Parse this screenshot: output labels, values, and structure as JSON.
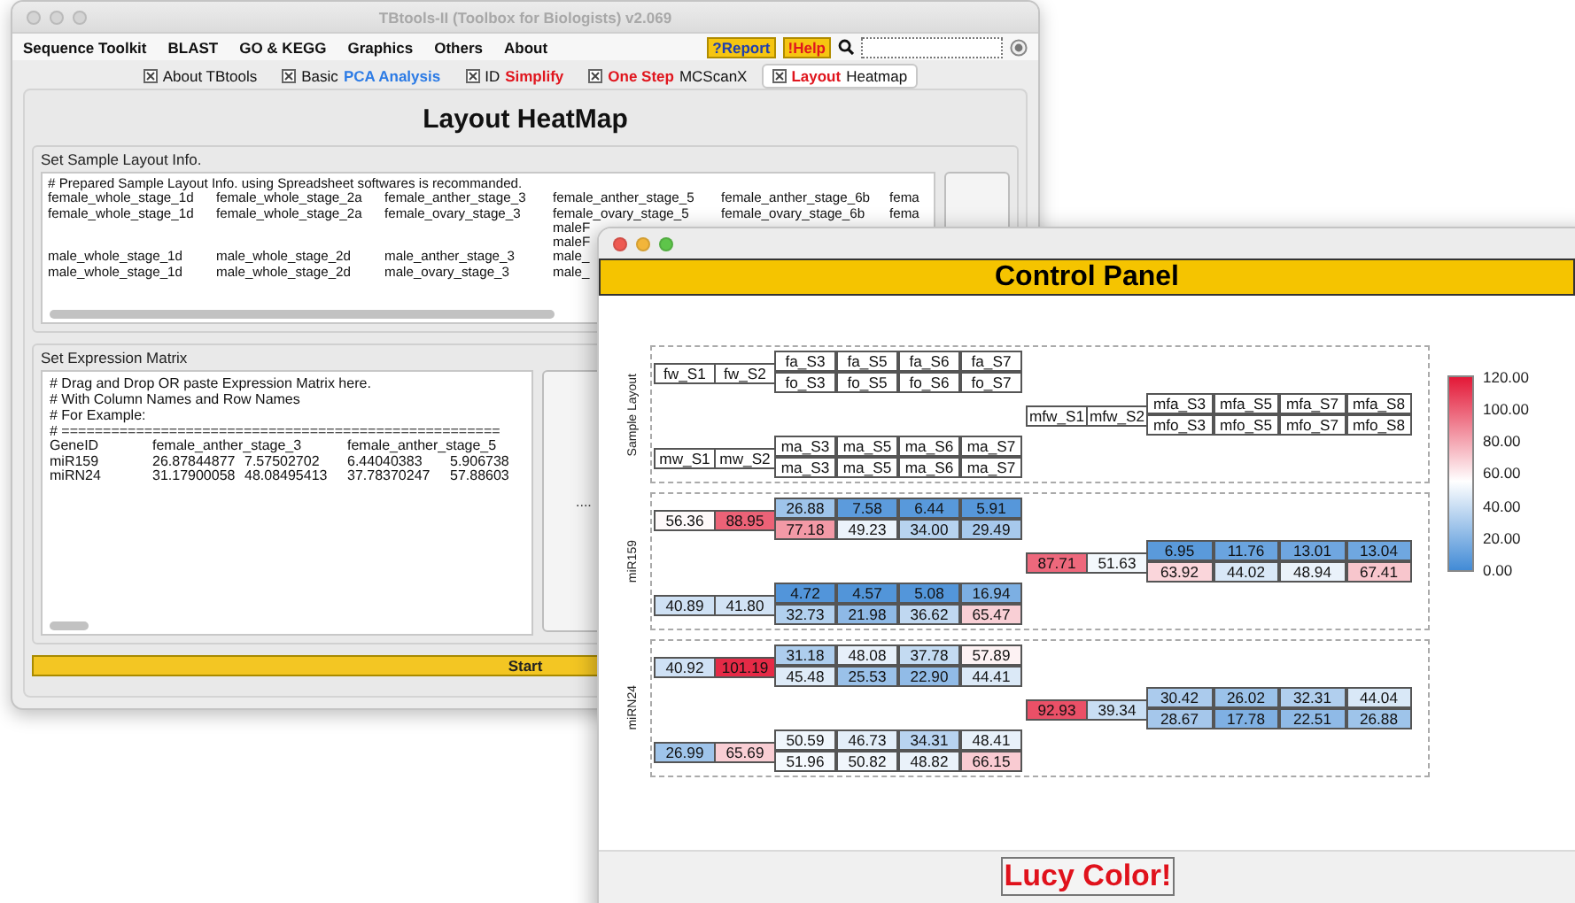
{
  "main_window": {
    "title": "TBtools-II (Toolbox for Biologists) v2.069",
    "menus": [
      "Sequence Toolkit",
      "BLAST",
      "GO & KEGG",
      "Graphics",
      "Others",
      "About"
    ],
    "report_button": "?Report",
    "help_button": "!Help",
    "tabs": [
      {
        "parts": [
          {
            "text": "About TBtools"
          }
        ],
        "selected": false
      },
      {
        "parts": [
          {
            "text": "Basic"
          },
          {
            "text": "PCA Analysis",
            "color": "#2c7be5"
          }
        ],
        "selected": false
      },
      {
        "parts": [
          {
            "text": "ID"
          },
          {
            "text": "Simplify",
            "color": "#e0161e"
          }
        ],
        "selected": false
      },
      {
        "parts": [
          {
            "text": "One Step",
            "color": "#e0161e"
          },
          {
            "text": "MCScanX"
          }
        ],
        "selected": false
      },
      {
        "parts": [
          {
            "text": "Layout",
            "color": "#e0161e"
          },
          {
            "text": "Heatmap"
          }
        ],
        "selected": true
      }
    ],
    "heading": "Layout HeatMap",
    "layout_panel": {
      "title": "Set Sample Layout Info.",
      "comment": "# Prepared Sample Layout Info. using Spreadsheet softwares is recommanded.",
      "rows": [
        [
          "female_whole_stage_1d",
          "female_whole_stage_2a",
          "female_anther_stage_3",
          "female_anther_stage_5",
          "female_anther_stage_6b",
          "fema"
        ],
        [
          "female_whole_stage_1d",
          "female_whole_stage_2a",
          "female_ovary_stage_3",
          "female_ovary_stage_5",
          "female_ovary_stage_6b",
          "fema"
        ],
        [
          null,
          null,
          null,
          "maleF"
        ],
        [
          null,
          null,
          null,
          "maleF"
        ],
        [
          "male_whole_stage_1d",
          "male_whole_stage_2d",
          "male_anther_stage_3",
          "male_"
        ],
        [
          "male_whole_stage_1d",
          "male_whole_stage_2d",
          "male_ovary_stage_3",
          "male_"
        ]
      ]
    },
    "matrix_panel": {
      "title": "Set Expression Matrix",
      "comments": [
        "# Drag and Drop OR paste Expression Matrix here.",
        "# With Column Names and Row Names",
        "# For Example:",
        "# ====================================================="
      ],
      "rows": [
        [
          "GeneID",
          "female_anther_stage_3",
          null,
          "female_anther_stage_5",
          null
        ],
        [
          "miR159",
          "26.87844877",
          "7.57502702",
          "6.44040383",
          "5.906738"
        ],
        [
          "miRN24",
          "31.17900058",
          "48.08495413",
          "37.78370247",
          "57.88603"
        ]
      ],
      "browse_button": "...."
    },
    "start_button": "Start"
  },
  "control_panel": {
    "title": "Control Panel",
    "groups": [
      {
        "label": "Sample Layout",
        "kind": "layout",
        "blocks": [
          {
            "singles": [
              "fw_S1",
              "fw_S2"
            ],
            "grid": [
              [
                "fa_S3",
                "fa_S5",
                "fa_S6",
                "fa_S7"
              ],
              [
                "fo_S3",
                "fo_S5",
                "fo_S6",
                "fo_S7"
              ]
            ]
          },
          {
            "singles": [
              "mfw_S1",
              "mfw_S2"
            ],
            "grid": [
              [
                "mfa_S3",
                "mfa_S5",
                "mfa_S7",
                "mfa_S8"
              ],
              [
                "mfo_S3",
                "mfo_S5",
                "mfo_S7",
                "mfo_S8"
              ]
            ]
          },
          {
            "singles": [
              "mw_S1",
              "mw_S2"
            ],
            "grid": [
              [
                "ma_S3",
                "ma_S5",
                "ma_S6",
                "ma_S7"
              ],
              [
                "ma_S3",
                "ma_S5",
                "ma_S6",
                "ma_S7"
              ]
            ]
          }
        ]
      },
      {
        "label": "miR159",
        "kind": "values",
        "blocks": [
          {
            "singles": [
              "56.36",
              "88.95"
            ],
            "grid": [
              [
                "26.88",
                "7.58",
                "6.44",
                "5.91"
              ],
              [
                "77.18",
                "49.23",
                "34.00",
                "29.49"
              ]
            ]
          },
          {
            "singles": [
              "87.71",
              "51.63"
            ],
            "grid": [
              [
                "6.95",
                "11.76",
                "13.01",
                "13.04"
              ],
              [
                "63.92",
                "44.02",
                "48.94",
                "67.41"
              ]
            ]
          },
          {
            "singles": [
              "40.89",
              "41.80"
            ],
            "grid": [
              [
                "4.72",
                "4.57",
                "5.08",
                "16.94"
              ],
              [
                "32.73",
                "21.98",
                "36.62",
                "65.47"
              ]
            ]
          }
        ]
      },
      {
        "label": "miRN24",
        "kind": "values",
        "blocks": [
          {
            "singles": [
              "40.92",
              "101.19"
            ],
            "grid": [
              [
                "31.18",
                "48.08",
                "37.78",
                "57.89"
              ],
              [
                "45.48",
                "25.53",
                "22.90",
                "44.41"
              ]
            ]
          },
          {
            "singles": [
              "92.93",
              "39.34"
            ],
            "grid": [
              [
                "30.42",
                "26.02",
                "32.31",
                "44.04"
              ],
              [
                "28.67",
                "17.78",
                "22.51",
                "26.88"
              ]
            ]
          },
          {
            "singles": [
              "26.99",
              "65.69"
            ],
            "grid": [
              [
                "50.59",
                "46.73",
                "34.31",
                "48.41"
              ],
              [
                "51.96",
                "50.82",
                "48.82",
                "66.15"
              ]
            ]
          }
        ]
      }
    ],
    "legend_ticks": [
      "120.00",
      "100.00",
      "80.00",
      "60.00",
      "40.00",
      "20.00",
      "0.00"
    ],
    "color_button": "Lucy Color!"
  }
}
